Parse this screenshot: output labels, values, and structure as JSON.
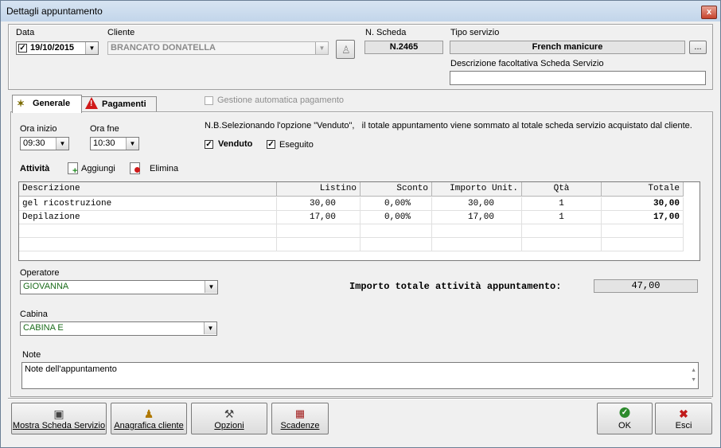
{
  "window": {
    "title": "Dettagli appuntamento",
    "close_glyph": "x"
  },
  "header": {
    "data_label": "Data",
    "data_value": "19/10/2015",
    "cliente_label": "Cliente",
    "cliente_value": "BRANCATO DONATELLA",
    "scheda_label": "N. Scheda",
    "scheda_value": "N.2465",
    "tipo_label": "Tipo servizio",
    "tipo_value": "French manicure",
    "tipo_button": "...",
    "descr_label": "Descrizione facoltativa Scheda Servizio",
    "descr_value": ""
  },
  "tabs": [
    {
      "label": "Generale",
      "icon": "sparkle-icon"
    },
    {
      "label": "Pagamenti",
      "icon": "warning-icon"
    }
  ],
  "gestione_label": "Gestione automatica pagamento",
  "general": {
    "ora_inizio_label": "Ora inizio",
    "ora_inizio_value": "09:30",
    "ora_fine_label": "Ora fne",
    "ora_fine_value": "10:30",
    "nb_text": "N.B.Selezionando l'opzione \"Venduto\",   il totale appuntamento viene sommato al totale scheda servizio acquistato dal cliente.",
    "venduto_label": "Venduto",
    "eseguito_label": "Eseguito",
    "attivita_label": "Attività",
    "aggiungi_label": "Aggiungi",
    "elimina_label": "Elimina"
  },
  "table": {
    "columns": [
      "Descrizione",
      "Listino",
      "Sconto",
      "Importo Unit.",
      "Qtà",
      "Totale"
    ],
    "rows": [
      [
        "gel ricostruzione",
        "30,00",
        "0,00%",
        "30,00",
        "1",
        "30,00"
      ],
      [
        "Depilazione",
        "17,00",
        "0,00%",
        "17,00",
        "1",
        "17,00"
      ]
    ]
  },
  "operatore_label": "Operatore",
  "operatore_value": "GIOVANNA",
  "cabina_label": "Cabina",
  "cabina_value": "CABINA E",
  "totale_label": "Importo totale attività appuntamento:",
  "totale_value": "47,00",
  "note_label": "Note",
  "note_value": "Note dell'appuntamento",
  "buttons": {
    "mostra": "Mostra Scheda Servizio",
    "anagrafica": "Anagrafica cliente",
    "opzioni": "Opzioni",
    "scadenze": "Scadenze",
    "ok": "OK",
    "esci": "Esci"
  },
  "colors": {
    "green_text": "#1a6b1a",
    "accent": "#c7432c"
  }
}
